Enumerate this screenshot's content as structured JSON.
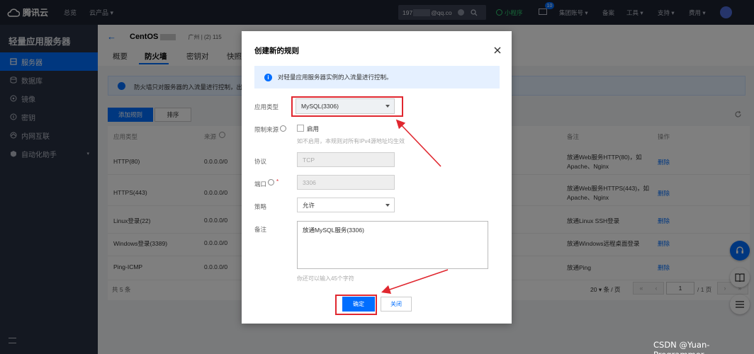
{
  "topbar": {
    "logo_text": "腾讯云",
    "nav": [
      "总览",
      "云产品 ▾"
    ],
    "search_text": "197",
    "search_suffix": "@qq.co",
    "mini_program": "小程序",
    "msg_count": "10",
    "items": [
      "集团账号 ▾",
      "备案",
      "工具 ▾",
      "支持 ▾",
      "费用 ▾"
    ]
  },
  "sidebar": {
    "title": "轻量应用服务器",
    "items": [
      {
        "label": "服务器",
        "icon": "server-icon",
        "active": true
      },
      {
        "label": "数据库",
        "icon": "database-icon",
        "active": false
      },
      {
        "label": "镜像",
        "icon": "image-icon",
        "active": false
      },
      {
        "label": "密钥",
        "icon": "key-icon",
        "active": false
      },
      {
        "label": "内网互联",
        "icon": "network-icon",
        "active": false
      },
      {
        "label": "自动化助手",
        "icon": "assistant-icon",
        "active": false
      }
    ]
  },
  "page": {
    "title": "CentOS",
    "region": "广州 | (2) 115",
    "tabs": [
      "概要",
      "防火墙",
      "密钥对",
      "快照"
    ],
    "active_tab": 1,
    "info_text": "防火墙只对服务器的入流量进行控制，出",
    "add_rule_button": "添加规则",
    "sort_button": "排序",
    "columns": [
      "应用类型",
      "来源",
      "备注",
      "操作"
    ],
    "rows": [
      {
        "app": "HTTP(80)",
        "source": "0.0.0.0/0",
        "note1": "放通Web服务HTTP(80)，如",
        "note2": "Apache、Nginx",
        "op": "删除"
      },
      {
        "app": "HTTPS(443)",
        "source": "0.0.0.0/0",
        "note1": "放通Web服务HTTPS(443)，如",
        "note2": "Apache、Nginx",
        "op": "删除"
      },
      {
        "app": "Linux登录(22)",
        "source": "0.0.0.0/0",
        "note1": "放通Linux SSH登录",
        "note2": "",
        "op": "删除"
      },
      {
        "app": "Windows登录(3389)",
        "source": "0.0.0.0/0",
        "note1": "放通Windows远程桌面登录",
        "note2": "",
        "op": "删除"
      },
      {
        "app": "Ping-ICMP",
        "source": "0.0.0.0/0",
        "note1": "放通Ping",
        "note2": "",
        "op": "删除"
      }
    ],
    "total": "共 5 条",
    "page_size": "20 ▾ 条 / 页",
    "page_num": "1",
    "page_total": "/ 1 页"
  },
  "modal": {
    "title": "创建新的规则",
    "info": "对轻量应用服务器实例的入流量进行控制。",
    "app_type_label": "应用类型",
    "app_type_value": "MySQL(3306)",
    "source_label": "限制来源",
    "enable_label": "启用",
    "source_hint": "如不启用，本规则对所有IPv4源地址均生效",
    "protocol_label": "协议",
    "protocol_value": "TCP",
    "port_label": "端口",
    "port_value": "3306",
    "policy_label": "策略",
    "policy_value": "允许",
    "note_label": "备注",
    "note_value": "放通MySQL服务(3306)",
    "char_hint": "你还可以输入45个字符",
    "ok_button": "确定",
    "close_button": "关闭"
  },
  "watermark": "CSDN @Yuan-Programmer",
  "colors": {
    "accent": "#006eff",
    "highlight": "#e0272f",
    "sidebar": "#293042",
    "topbar": "#1d2231"
  }
}
